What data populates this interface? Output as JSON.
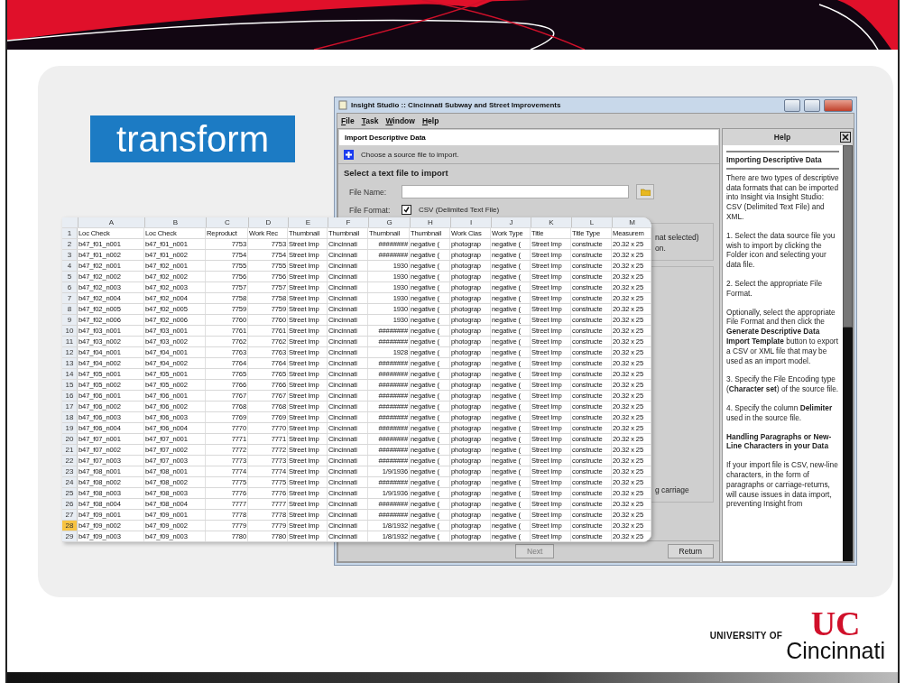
{
  "slide": {
    "tag": "transform"
  },
  "app": {
    "title": "Insight Studio :: Cincinnati Subway and Street Improvements",
    "menu": [
      "File",
      "Task",
      "Window",
      "Help"
    ],
    "panel_title": "Import Descriptive Data",
    "instruction": "Choose a source file to import.",
    "section_title": "Select a text file to import",
    "file_name": {
      "label": "File Name:"
    },
    "file_format": {
      "label": "File Format:",
      "option": "CSV (Delimited Text File)",
      "checked": true
    },
    "group_1_texts": [
      "nat selected)",
      "on."
    ],
    "group_2_text": "g carriage",
    "buttons": [
      {
        "label": "Next",
        "disabled": true
      },
      {
        "label": "Return",
        "disabled": false
      }
    ]
  },
  "help": {
    "title": "Help",
    "paragraphs": [
      {
        "kind": "heading",
        "text": "Importing Descriptive Data"
      },
      {
        "kind": "text",
        "text": "There are two types of descriptive data formats that can be imported into Insight via Insight Studio: CSV (Delimited Text File) and XML."
      },
      {
        "kind": "text",
        "text": "1. Select the data source file you wish to import by clicking the Folder icon and selecting your data file."
      },
      {
        "kind": "text",
        "text": "2. Select the appropriate File Format."
      },
      {
        "kind": "text",
        "text": "Optionally, select the appropriate File Format and then click the **Generate Descriptive Data Import Template** button to export a CSV or XML file that may be used as an import model."
      },
      {
        "kind": "text",
        "text": "3. Specify the File Encoding type (**Character set**) of the source file."
      },
      {
        "kind": "text",
        "text": "4. Specify the column **Delimiter** used in the source file."
      },
      {
        "kind": "subheading",
        "text": "Handling Paragraphs or New-Line Characters in your Data"
      },
      {
        "kind": "text",
        "text": "If your import file is CSV, new-line characters, in the form of paragraphs or carriage-returns, will cause issues in data import, preventing Insight from"
      }
    ]
  },
  "spreadsheet": {
    "columns": [
      {
        "letter": "A",
        "kind": "text"
      },
      {
        "letter": "B",
        "kind": "text"
      },
      {
        "letter": "C",
        "kind": "number"
      },
      {
        "letter": "D",
        "kind": "number"
      },
      {
        "letter": "E",
        "kind": "text"
      },
      {
        "letter": "F",
        "kind": "text"
      },
      {
        "letter": "G",
        "kind": "number"
      },
      {
        "letter": "H",
        "kind": "text"
      },
      {
        "letter": "I",
        "kind": "text"
      },
      {
        "letter": "J",
        "kind": "text"
      },
      {
        "letter": "K",
        "kind": "text"
      },
      {
        "letter": "L",
        "kind": "text"
      },
      {
        "letter": "M",
        "kind": "text"
      }
    ],
    "rows": [
      {
        "number": "1",
        "kind": "header",
        "selected": false,
        "cells": [
          "Loc Check",
          "Loc Check",
          "Reproduct",
          "Work Rec",
          "Thumbnail",
          "Thumbnail",
          "Thumbnail",
          "Thumbnail",
          "Work Clas",
          "Work Type",
          "Title",
          "Title Type",
          "Measurem"
        ]
      },
      {
        "number": "2",
        "kind": "data",
        "selected": false,
        "cells": [
          "b47_f01_n001",
          "b47_f01_n001",
          "7753",
          "7753",
          "Street Imp",
          "Cincinnati",
          "########",
          "negative (",
          "photograp",
          "negative (",
          "Street Imp",
          "constructe",
          "20.32 x 25"
        ]
      },
      {
        "number": "3",
        "kind": "data",
        "selected": false,
        "cells": [
          "b47_f01_n002",
          "b47_f01_n002",
          "7754",
          "7754",
          "Street Imp",
          "Cincinnati",
          "########",
          "negative (",
          "photograp",
          "negative (",
          "Street Imp",
          "constructe",
          "20.32 x 25"
        ]
      },
      {
        "number": "4",
        "kind": "data",
        "selected": false,
        "cells": [
          "b47_f02_n001",
          "b47_f02_n001",
          "7755",
          "7755",
          "Street Imp",
          "Cincinnati",
          "1930",
          "negative (",
          "photograp",
          "negative (",
          "Street Imp",
          "constructe",
          "20.32 x 25"
        ]
      },
      {
        "number": "5",
        "kind": "data",
        "selected": false,
        "cells": [
          "b47_f02_n002",
          "b47_f02_n002",
          "7756",
          "7756",
          "Street Imp",
          "Cincinnati",
          "1930",
          "negative (",
          "photograp",
          "negative (",
          "Street Imp",
          "constructe",
          "20.32 x 25"
        ]
      },
      {
        "number": "6",
        "kind": "data",
        "selected": false,
        "cells": [
          "b47_f02_n003",
          "b47_f02_n003",
          "7757",
          "7757",
          "Street Imp",
          "Cincinnati",
          "1930",
          "negative (",
          "photograp",
          "negative (",
          "Street Imp",
          "constructe",
          "20.32 x 25"
        ]
      },
      {
        "number": "7",
        "kind": "data",
        "selected": false,
        "cells": [
          "b47_f02_n004",
          "b47_f02_n004",
          "7758",
          "7758",
          "Street Imp",
          "Cincinnati",
          "1930",
          "negative (",
          "photograp",
          "negative (",
          "Street Imp",
          "constructe",
          "20.32 x 25"
        ]
      },
      {
        "number": "8",
        "kind": "data",
        "selected": false,
        "cells": [
          "b47_f02_n005",
          "b47_f02_n005",
          "7759",
          "7759",
          "Street Imp",
          "Cincinnati",
          "1930",
          "negative (",
          "photograp",
          "negative (",
          "Street Imp",
          "constructe",
          "20.32 x 25"
        ]
      },
      {
        "number": "9",
        "kind": "data",
        "selected": false,
        "cells": [
          "b47_f02_n006",
          "b47_f02_n006",
          "7760",
          "7760",
          "Street Imp",
          "Cincinnati",
          "1930",
          "negative (",
          "photograp",
          "negative (",
          "Street Imp",
          "constructe",
          "20.32 x 25"
        ]
      },
      {
        "number": "10",
        "kind": "data",
        "selected": false,
        "cells": [
          "b47_f03_n001",
          "b47_f03_n001",
          "7761",
          "7761",
          "Street Imp",
          "Cincinnati",
          "########",
          "negative (",
          "photograp",
          "negative (",
          "Street Imp",
          "constructe",
          "20.32 x 25"
        ]
      },
      {
        "number": "11",
        "kind": "data",
        "selected": false,
        "cells": [
          "b47_f03_n002",
          "b47_f03_n002",
          "7762",
          "7762",
          "Street Imp",
          "Cincinnati",
          "########",
          "negative (",
          "photograp",
          "negative (",
          "Street Imp",
          "constructe",
          "20.32 x 25"
        ]
      },
      {
        "number": "12",
        "kind": "data",
        "selected": false,
        "cells": [
          "b47_f04_n001",
          "b47_f04_n001",
          "7763",
          "7763",
          "Street Imp",
          "Cincinnati",
          "1928",
          "negative (",
          "photograp",
          "negative (",
          "Street Imp",
          "constructe",
          "20.32 x 25"
        ]
      },
      {
        "number": "13",
        "kind": "data",
        "selected": false,
        "cells": [
          "b47_f04_n002",
          "b47_f04_n002",
          "7764",
          "7764",
          "Street Imp",
          "Cincinnati",
          "########",
          "negative (",
          "photograp",
          "negative (",
          "Street Imp",
          "constructe",
          "20.32 x 25"
        ]
      },
      {
        "number": "14",
        "kind": "data",
        "selected": false,
        "cells": [
          "b47_f05_n001",
          "b47_f05_n001",
          "7765",
          "7765",
          "Street Imp",
          "Cincinnati",
          "########",
          "negative (",
          "photograp",
          "negative (",
          "Street Imp",
          "constructe",
          "20.32 x 25"
        ]
      },
      {
        "number": "15",
        "kind": "data",
        "selected": false,
        "cells": [
          "b47_f05_n002",
          "b47_f05_n002",
          "7766",
          "7766",
          "Street Imp",
          "Cincinnati",
          "########",
          "negative (",
          "photograp",
          "negative (",
          "Street Imp",
          "constructe",
          "20.32 x 25"
        ]
      },
      {
        "number": "16",
        "kind": "data",
        "selected": false,
        "cells": [
          "b47_f06_n001",
          "b47_f06_n001",
          "7767",
          "7767",
          "Street Imp",
          "Cincinnati",
          "########",
          "negative (",
          "photograp",
          "negative (",
          "Street Imp",
          "constructe",
          "20.32 x 25"
        ]
      },
      {
        "number": "17",
        "kind": "data",
        "selected": false,
        "cells": [
          "b47_f06_n002",
          "b47_f06_n002",
          "7768",
          "7768",
          "Street Imp",
          "Cincinnati",
          "########",
          "negative (",
          "photograp",
          "negative (",
          "Street Imp",
          "constructe",
          "20.32 x 25"
        ]
      },
      {
        "number": "18",
        "kind": "data",
        "selected": false,
        "cells": [
          "b47_f06_n003",
          "b47_f06_n003",
          "7769",
          "7769",
          "Street Imp",
          "Cincinnati",
          "########",
          "negative (",
          "photograp",
          "negative (",
          "Street Imp",
          "constructe",
          "20.32 x 25"
        ]
      },
      {
        "number": "19",
        "kind": "data",
        "selected": false,
        "cells": [
          "b47_f06_n004",
          "b47_f06_n004",
          "7770",
          "7770",
          "Street Imp",
          "Cincinnati",
          "########",
          "negative (",
          "photograp",
          "negative (",
          "Street Imp",
          "constructe",
          "20.32 x 25"
        ]
      },
      {
        "number": "20",
        "kind": "data",
        "selected": false,
        "cells": [
          "b47_f07_n001",
          "b47_f07_n001",
          "7771",
          "7771",
          "Street Imp",
          "Cincinnati",
          "########",
          "negative (",
          "photograp",
          "negative (",
          "Street Imp",
          "constructe",
          "20.32 x 25"
        ]
      },
      {
        "number": "21",
        "kind": "data",
        "selected": false,
        "cells": [
          "b47_f07_n002",
          "b47_f07_n002",
          "7772",
          "7772",
          "Street Imp",
          "Cincinnati",
          "########",
          "negative (",
          "photograp",
          "negative (",
          "Street Imp",
          "constructe",
          "20.32 x 25"
        ]
      },
      {
        "number": "22",
        "kind": "data",
        "selected": false,
        "cells": [
          "b47_f07_n003",
          "b47_f07_n003",
          "7773",
          "7773",
          "Street Imp",
          "Cincinnati",
          "########",
          "negative (",
          "photograp",
          "negative (",
          "Street Imp",
          "constructe",
          "20.32 x 25"
        ]
      },
      {
        "number": "23",
        "kind": "data",
        "selected": false,
        "cells": [
          "b47_f08_n001",
          "b47_f08_n001",
          "7774",
          "7774",
          "Street Imp",
          "Cincinnati",
          "1/9/1936",
          "negative (",
          "photograp",
          "negative (",
          "Street Imp",
          "constructe",
          "20.32 x 25"
        ]
      },
      {
        "number": "24",
        "kind": "data",
        "selected": false,
        "cells": [
          "b47_f08_n002",
          "b47_f08_n002",
          "7775",
          "7775",
          "Street Imp",
          "Cincinnati",
          "########",
          "negative (",
          "photograp",
          "negative (",
          "Street Imp",
          "constructe",
          "20.32 x 25"
        ]
      },
      {
        "number": "25",
        "kind": "data",
        "selected": false,
        "cells": [
          "b47_f08_n003",
          "b47_f08_n003",
          "7776",
          "7776",
          "Street Imp",
          "Cincinnati",
          "1/9/1936",
          "negative (",
          "photograp",
          "negative (",
          "Street Imp",
          "constructe",
          "20.32 x 25"
        ]
      },
      {
        "number": "26",
        "kind": "data",
        "selected": false,
        "cells": [
          "b47_f08_n004",
          "b47_f08_n004",
          "7777",
          "7777",
          "Street Imp",
          "Cincinnati",
          "########",
          "negative (",
          "photograp",
          "negative (",
          "Street Imp",
          "constructe",
          "20.32 x 25"
        ]
      },
      {
        "number": "27",
        "kind": "data",
        "selected": false,
        "cells": [
          "b47_f09_n001",
          "b47_f09_n001",
          "7778",
          "7778",
          "Street Imp",
          "Cincinnati",
          "########",
          "negative (",
          "photograp",
          "negative (",
          "Street Imp",
          "constructe",
          "20.32 x 25"
        ]
      },
      {
        "number": "28",
        "kind": "data",
        "selected": true,
        "cells": [
          "b47_f09_n002",
          "b47_f09_n002",
          "7779",
          "7779",
          "Street Imp",
          "Cincinnati",
          "1/8/1932",
          "negative (",
          "photograp",
          "negative (",
          "Street Imp",
          "constructe",
          "20.32 x 25"
        ]
      },
      {
        "number": "29",
        "kind": "data",
        "selected": false,
        "cells": [
          "b47_f09_n003",
          "b47_f09_n003",
          "7780",
          "7780",
          "Street Imp",
          "Cincinnati",
          "1/8/1932",
          "negative (",
          "photograp",
          "negative (",
          "Street Imp",
          "constructe",
          "20.32 x 25"
        ]
      }
    ]
  },
  "logo": {
    "prefix": "UNIVERSITY OF",
    "mark": "UC",
    "name": "Cincinnati"
  }
}
